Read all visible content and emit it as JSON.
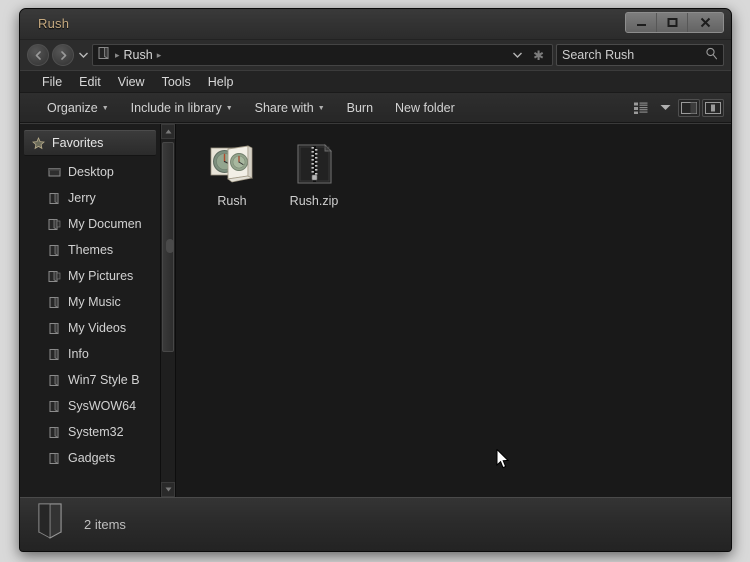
{
  "window": {
    "title": "Rush",
    "controls": [
      {
        "name": "minimize",
        "glyph": "minimize-icon"
      },
      {
        "name": "maximize",
        "glyph": "maximize-icon"
      },
      {
        "name": "close",
        "glyph": "close-icon"
      }
    ]
  },
  "address": {
    "back_icon": "back-arrow-icon",
    "forward_icon": "forward-arrow-icon",
    "recent_icon": "chevron-down-icon",
    "root_icon": "folder-icon",
    "crumbs": [
      "Rush"
    ],
    "separator": "▸",
    "dropdown_icon": "chevron-down-icon",
    "refresh_icon": "refresh-icon",
    "refresh_glyph": "✱"
  },
  "search": {
    "value": "Search Rush",
    "placeholder": "Search Rush",
    "icon": "search-icon"
  },
  "menu": {
    "items": [
      {
        "label": "File"
      },
      {
        "label": "Edit"
      },
      {
        "label": "View"
      },
      {
        "label": "Tools"
      },
      {
        "label": "Help"
      }
    ]
  },
  "toolbar": {
    "buttons": [
      {
        "label": "Organize",
        "has_caret": true
      },
      {
        "label": "Include in library",
        "has_caret": true
      },
      {
        "label": "Share with",
        "has_caret": true
      },
      {
        "label": "Burn",
        "has_caret": false
      },
      {
        "label": "New folder",
        "has_caret": false
      }
    ],
    "view_mode_icon": "view-list-icon",
    "view_caret_icon": "chevron-down-icon",
    "preview_pane_icon": "preview-pane-icon",
    "help_pane_icon": "details-pane-icon"
  },
  "sidebar": {
    "items": [
      {
        "label": "Favorites",
        "icon": "star-icon",
        "type": "header",
        "selected": true
      },
      {
        "label": "Desktop",
        "icon": "desktop-icon",
        "type": "child"
      },
      {
        "label": "Jerry",
        "icon": "folder-icon",
        "type": "child"
      },
      {
        "label": "My Documen",
        "icon": "documents-folder-icon",
        "type": "child"
      },
      {
        "label": "Themes",
        "icon": "folder-icon",
        "type": "child"
      },
      {
        "label": "My Pictures",
        "icon": "pictures-folder-icon",
        "type": "child"
      },
      {
        "label": "My Music",
        "icon": "folder-icon",
        "type": "child"
      },
      {
        "label": "My Videos",
        "icon": "folder-icon",
        "type": "child"
      },
      {
        "label": "Info",
        "icon": "folder-icon",
        "type": "child"
      },
      {
        "label": "Win7 Style B",
        "icon": "folder-icon",
        "type": "child"
      },
      {
        "label": "SysWOW64",
        "icon": "folder-icon",
        "type": "child"
      },
      {
        "label": "System32",
        "icon": "folder-icon",
        "type": "child"
      },
      {
        "label": "Gadgets",
        "icon": "folder-icon",
        "type": "child"
      }
    ],
    "scrollbar": {
      "up_glyph": "▲",
      "down_glyph": "▼"
    }
  },
  "files": [
    {
      "name": "Rush",
      "icon": "picture-folder-icon",
      "kind": "folder"
    },
    {
      "name": "Rush.zip",
      "icon": "zip-archive-icon",
      "kind": "archive"
    }
  ],
  "status": {
    "icon": "folder-icon",
    "text": "2 items"
  },
  "colors": {
    "window_bg": "#2c2c2c",
    "content_bg": "#191919",
    "title_text": "#c5a97f",
    "body_text": "#d2d2d2",
    "desktop_bg": "#d9d9d9"
  }
}
